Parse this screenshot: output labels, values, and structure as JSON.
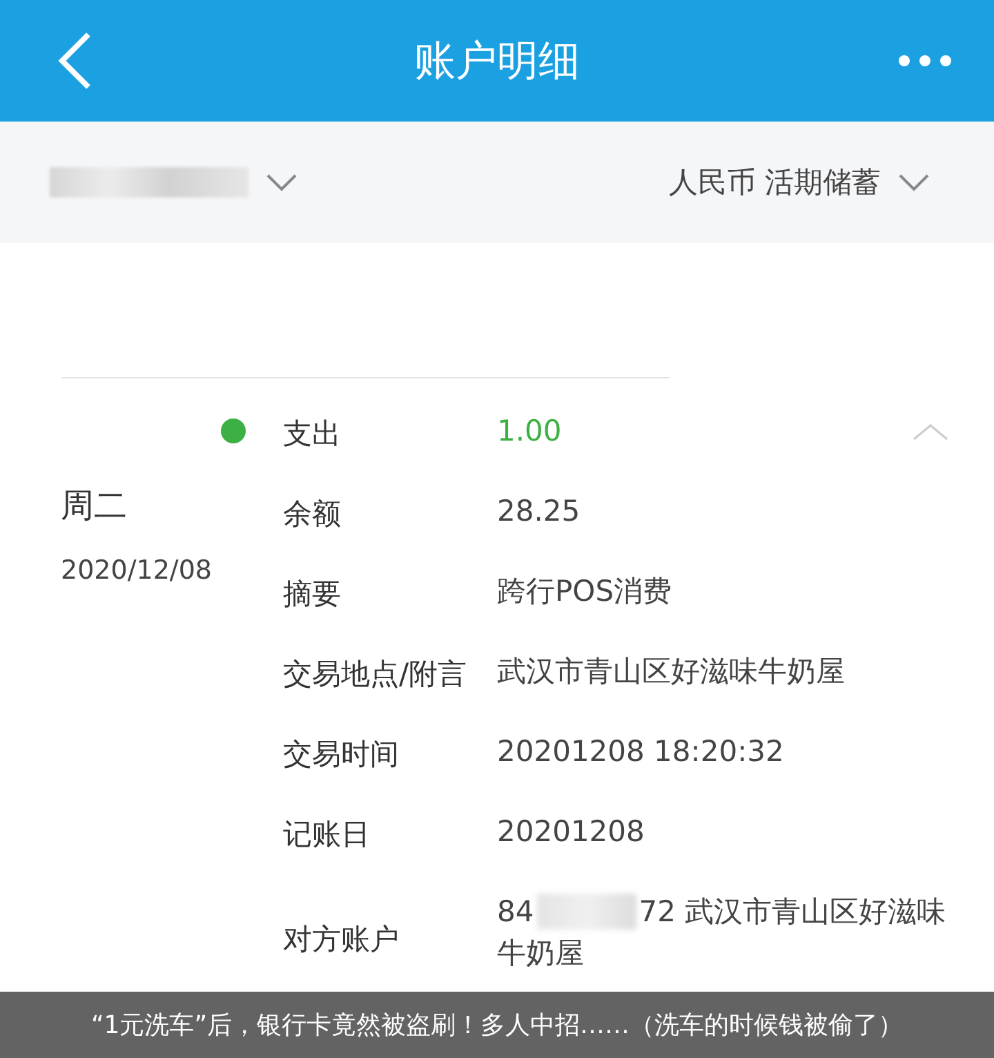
{
  "header": {
    "title": "账户明细"
  },
  "filter_bar": {
    "currency_account": "人民币 活期储蓄"
  },
  "transaction": {
    "weekday": "周二",
    "date": "2020/12/08",
    "type": "支出",
    "amount": "1.00",
    "color": "#3cb043",
    "expanded": true,
    "rows": [
      {
        "kind": "plain",
        "label": "余额",
        "value": "28.25"
      },
      {
        "kind": "plain",
        "label": "摘要",
        "value": "跨行POS消费"
      },
      {
        "kind": "plain",
        "label": "交易地点/附言",
        "value": "武汉市青山区好滋味牛奶屋"
      },
      {
        "kind": "plain",
        "label": "交易时间",
        "value": "20201208 18:20:32"
      },
      {
        "kind": "plain",
        "label": "记账日",
        "value": "20201208"
      },
      {
        "kind": "masked",
        "label": "对方账户",
        "value_start": "84",
        "value_end": "72 武汉市青山区好滋味",
        "value_wrap": "牛奶屋"
      }
    ]
  },
  "caption": "“1元洗车”后，银行卡竟然被盗刷！多人中招……（洗车的时候钱被偷了）"
}
